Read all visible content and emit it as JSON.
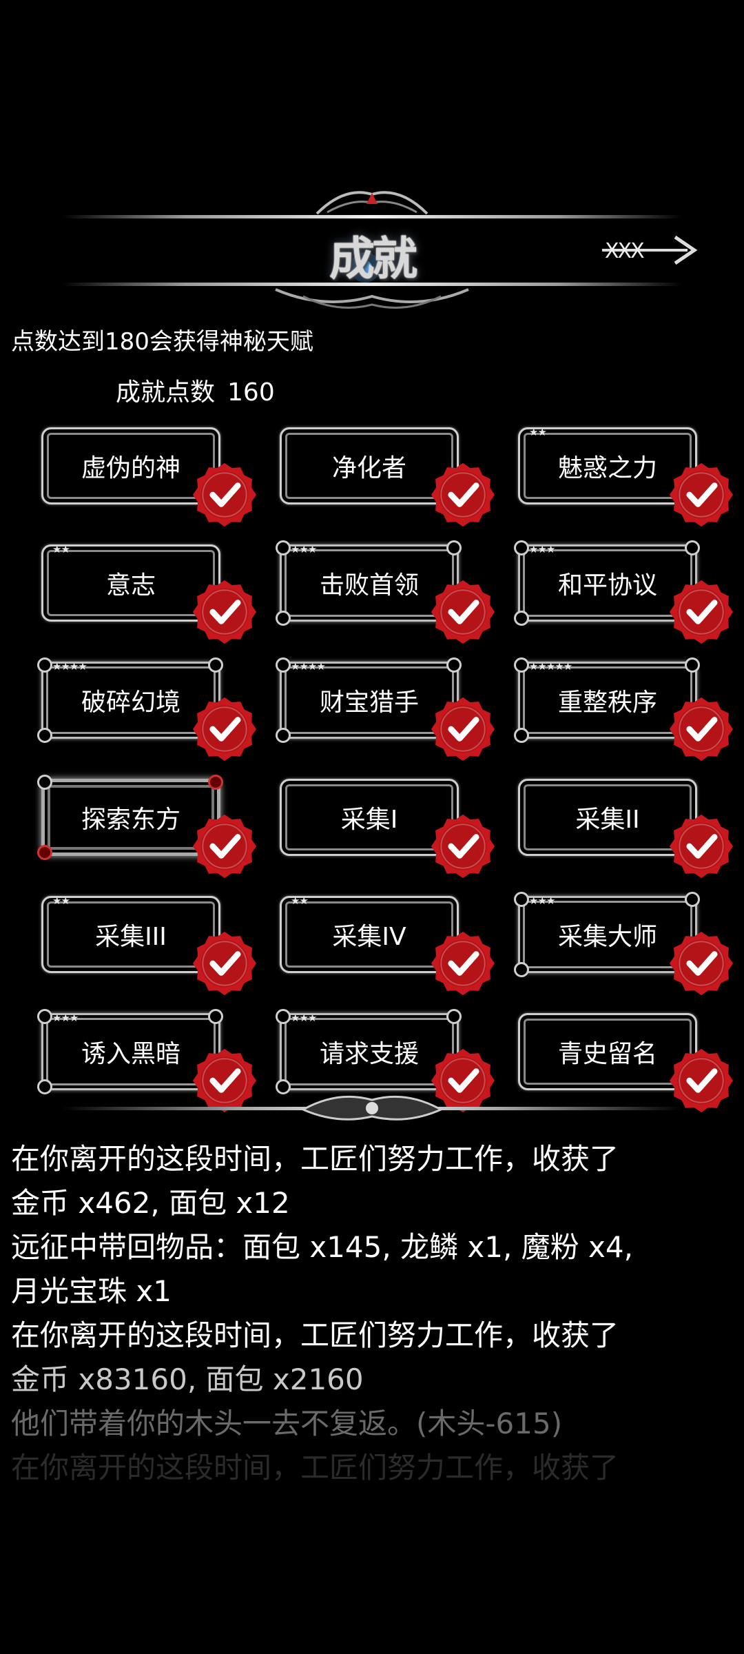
{
  "header": {
    "title": "成就",
    "back_label": "XXX"
  },
  "hint": "点数达到180会获得神秘天赋",
  "points": {
    "label": "成就点数",
    "value": "160"
  },
  "achievements": [
    {
      "label": "虚伪的神",
      "stars": "",
      "frame": "plain",
      "completed": true
    },
    {
      "label": "净化者",
      "stars": "",
      "frame": "plain",
      "completed": true
    },
    {
      "label": "魅惑之力",
      "stars": "★★",
      "frame": "plain",
      "completed": true
    },
    {
      "label": "意志",
      "stars": "★★",
      "frame": "plain",
      "completed": true
    },
    {
      "label": "击败首领",
      "stars": "★★★",
      "frame": "ornate",
      "completed": true
    },
    {
      "label": "和平协议",
      "stars": "★★★",
      "frame": "ornate",
      "completed": true
    },
    {
      "label": "破碎幻境",
      "stars": "★★★★",
      "frame": "ornate",
      "completed": true
    },
    {
      "label": "财宝猎手",
      "stars": "★★★★",
      "frame": "ornate",
      "completed": true
    },
    {
      "label": "重整秩序",
      "stars": "★★★★★",
      "frame": "ornate",
      "completed": true
    },
    {
      "label": "探索东方",
      "stars": "",
      "frame": "gem",
      "completed": true
    },
    {
      "label": "采集I",
      "stars": "",
      "frame": "plain",
      "completed": true
    },
    {
      "label": "采集II",
      "stars": "",
      "frame": "plain",
      "completed": true
    },
    {
      "label": "采集III",
      "stars": "★★",
      "frame": "plain",
      "completed": true
    },
    {
      "label": "采集IV",
      "stars": "★★",
      "frame": "plain",
      "completed": true
    },
    {
      "label": "采集大师",
      "stars": "★★★",
      "frame": "ornate",
      "completed": true
    },
    {
      "label": "诱入黑暗",
      "stars": "★★★",
      "frame": "ornate",
      "completed": true
    },
    {
      "label": "请求支援",
      "stars": "★★★",
      "frame": "ornate",
      "completed": true
    },
    {
      "label": "青史留名",
      "stars": "",
      "frame": "plain",
      "completed": true
    }
  ],
  "log": [
    "在你离开的这段时间，工匠们努力工作，收获了",
    "金币 x462, 面包 x12",
    "远征中带回物品：面包 x145, 龙鳞 x1, 魔粉 x4,",
    "月光宝珠 x1",
    "在你离开的这段时间，工匠们努力工作，收获了",
    "金币 x83160, 面包 x2160",
    "他们带着你的木头一去不复返。(木头-615)",
    "在你离开的这段时间，工匠们努力工作，收获了"
  ],
  "colors": {
    "seal_red": "#c8171d",
    "seal_dark": "#8e0d12",
    "frame_silver": "#cfcfcf",
    "background": "#000000"
  }
}
